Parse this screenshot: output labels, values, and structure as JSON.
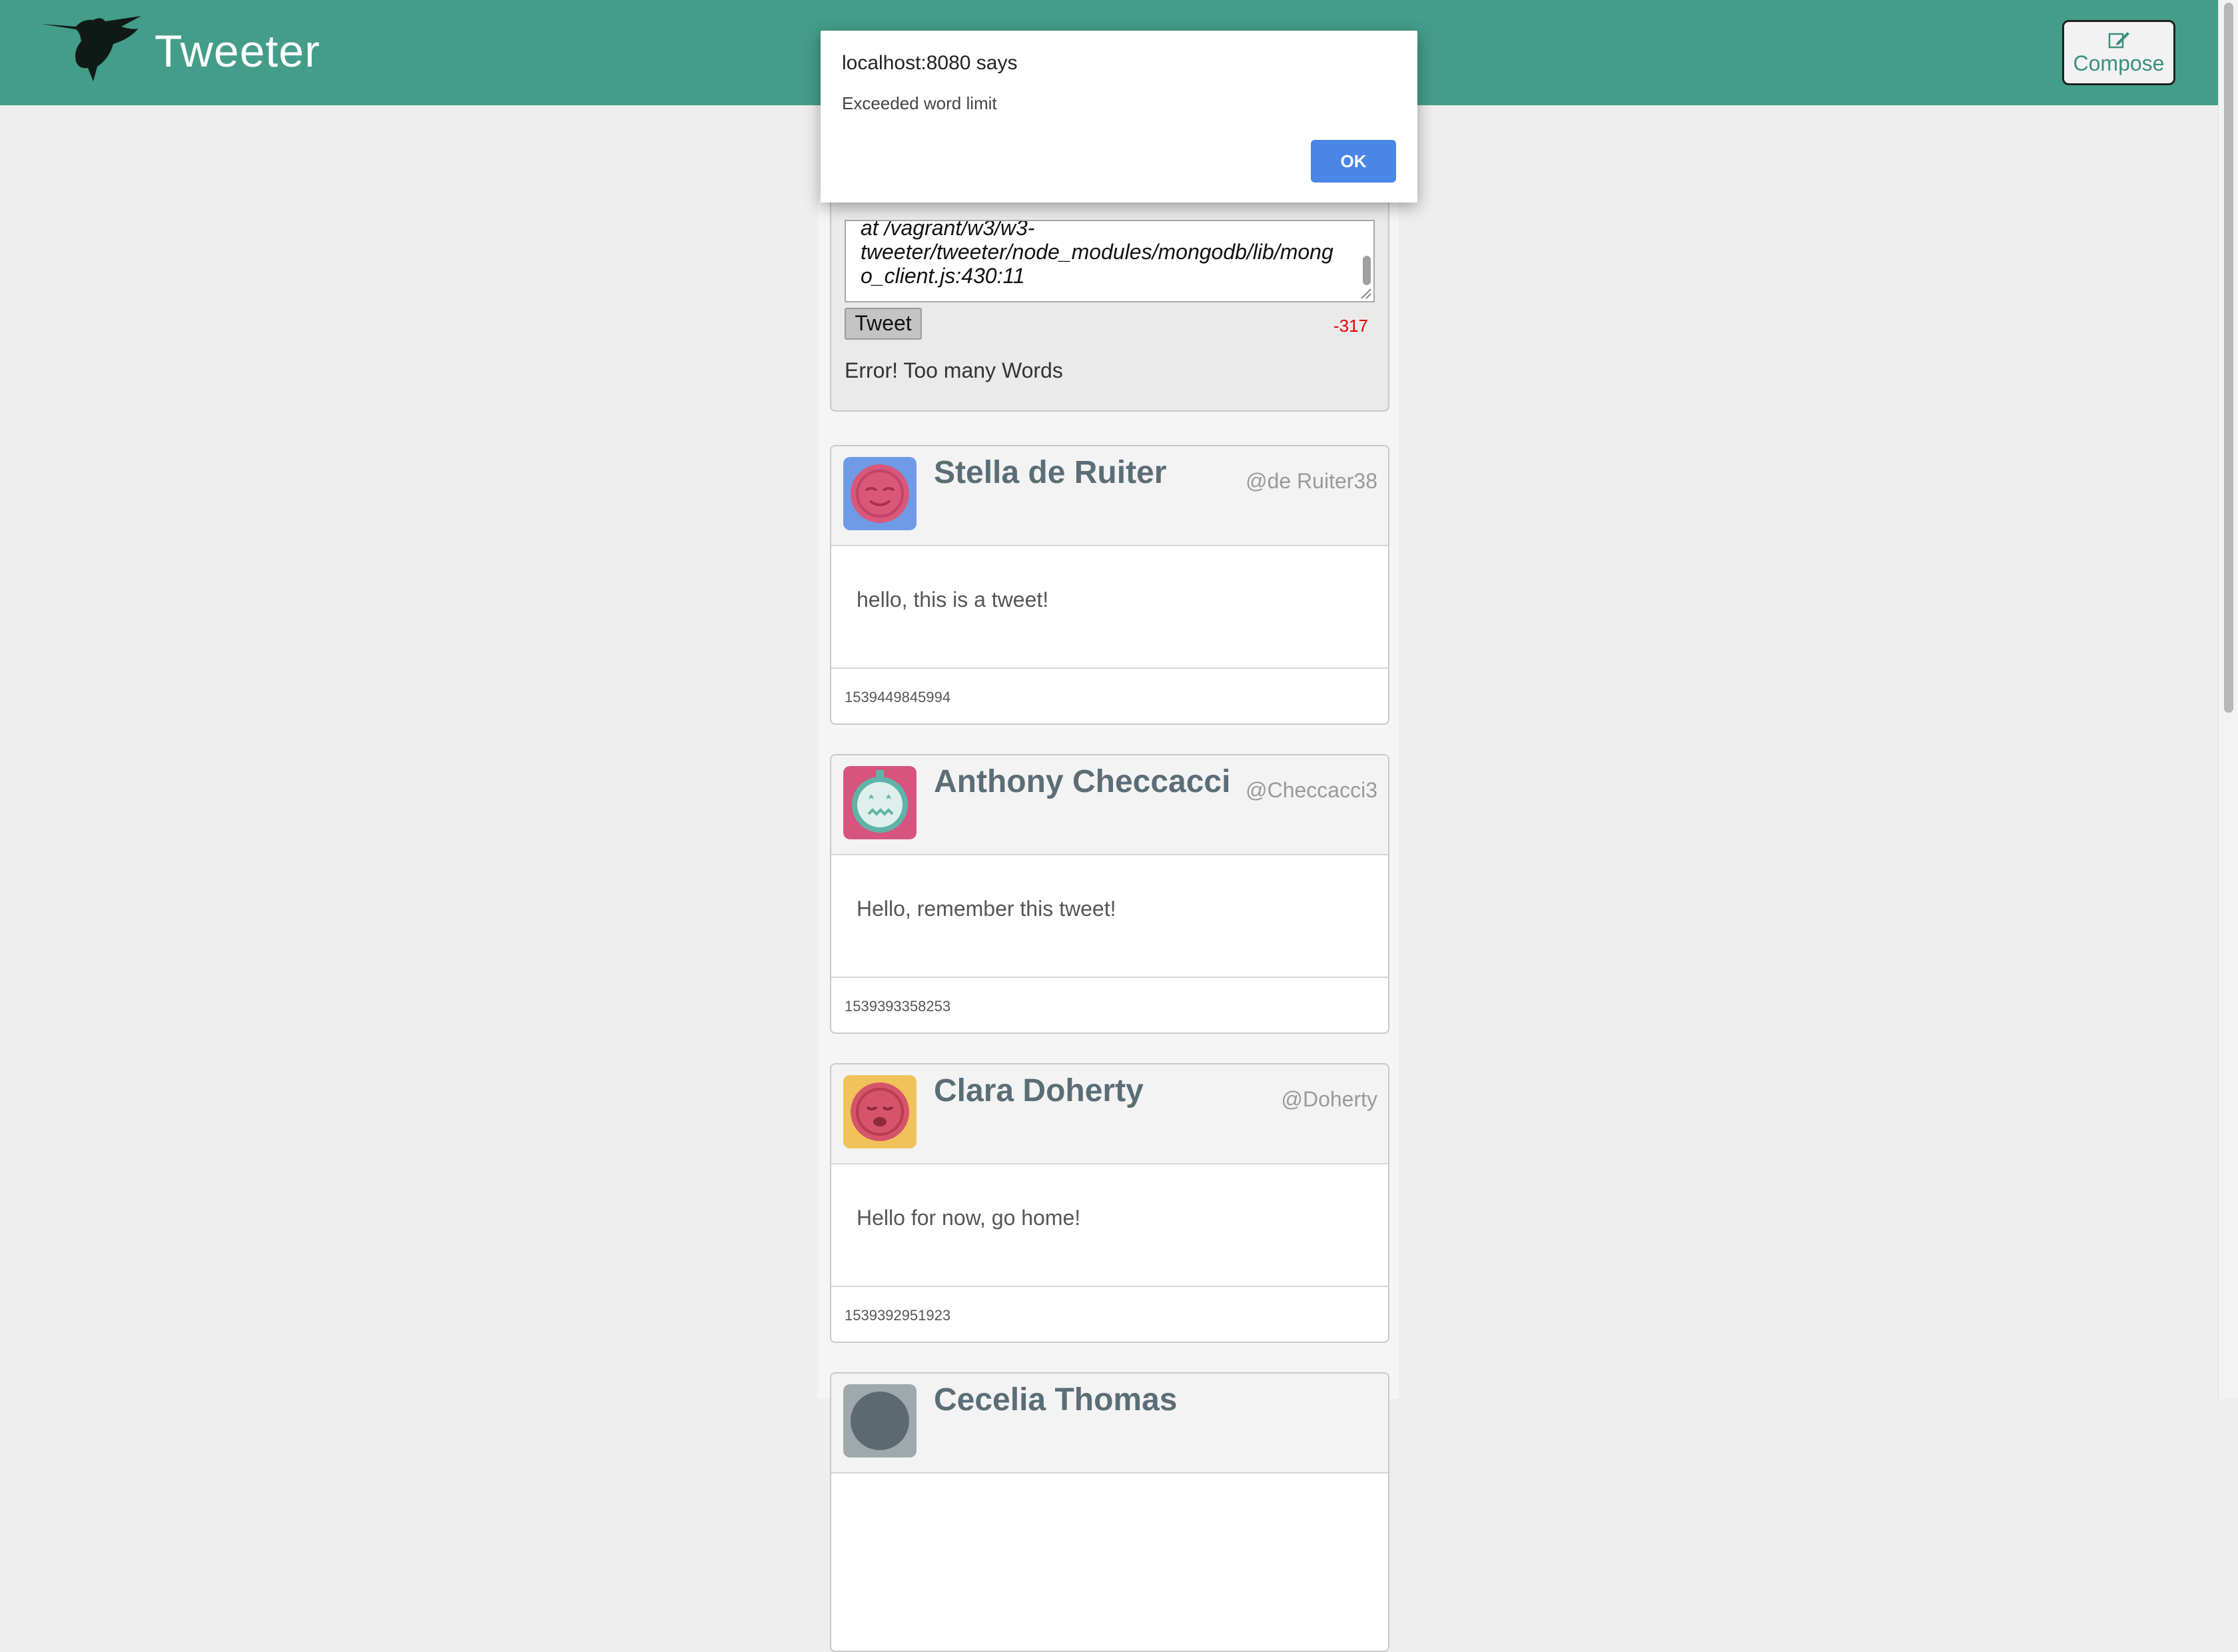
{
  "header": {
    "brand": "Tweeter",
    "compose_label": "Compose",
    "background_color": "#449d89"
  },
  "compose": {
    "textarea_text": "at /vagrant/w3/w3-\ntweeter/tweeter/node_modules/mongodb/lib/mong\no_client.js:430:11",
    "tweet_button": "Tweet",
    "counter": "-317",
    "error": "Error! Too many Words"
  },
  "tweets": [
    {
      "name": "Stella de Ruiter",
      "handle": "@de Ruiter38",
      "content": "hello, this is a tweet!",
      "timestamp": "1539449845994",
      "avatar_bg": "#6f9be6",
      "avatar_face": "#d9587a"
    },
    {
      "name": "Anthony Checcacci",
      "handle": "@Checcacci3",
      "content": "Hello, remember this tweet!",
      "timestamp": "1539393358253",
      "avatar_bg": "#d6547e",
      "avatar_face": "#5fb3a8"
    },
    {
      "name": "Clara Doherty",
      "handle": "@Doherty",
      "content": "Hello for now, go home!",
      "timestamp": "1539392951923",
      "avatar_bg": "#f0c35a",
      "avatar_face": "#d6546a"
    },
    {
      "name": "Cecelia Thomas",
      "avatar_bg": "#9fa9ad",
      "avatar_face": "#5a6a70"
    }
  ],
  "dialog": {
    "title": "localhost:8080 says",
    "message": "Exceeded word limit",
    "ok_label": "OK",
    "ok_color": "#4a86e8"
  }
}
